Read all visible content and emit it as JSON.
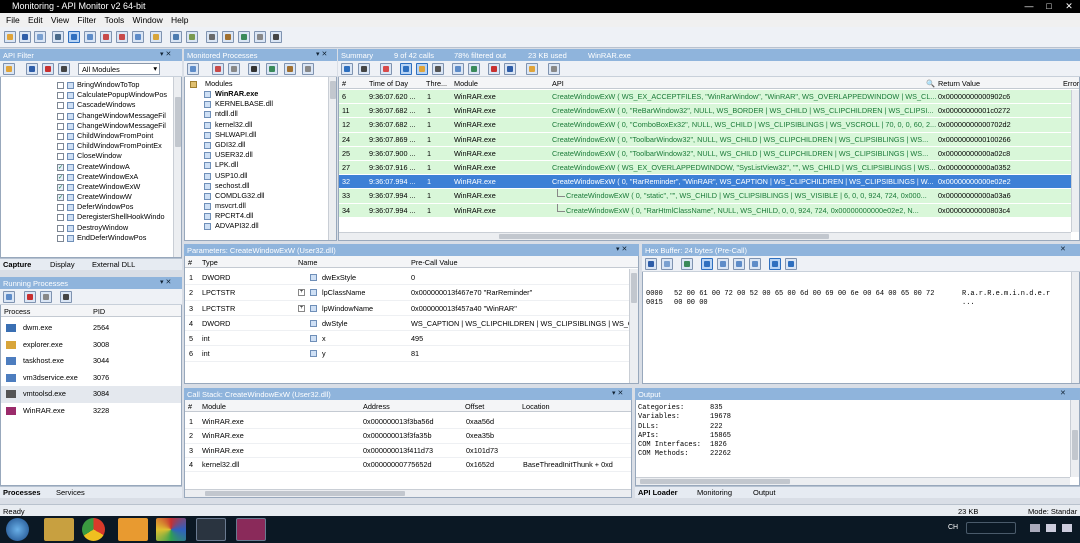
{
  "window": {
    "title": "Monitoring - API Monitor v2 64-bit"
  },
  "menu": [
    "File",
    "Edit",
    "View",
    "Filter",
    "Tools",
    "Window",
    "Help"
  ],
  "api_filter": {
    "title": "API Filter",
    "dropdown": "All Modules",
    "items": [
      {
        "label": "BringWindowToTop",
        "checked": false
      },
      {
        "label": "CalculatePopupWindowPos",
        "checked": false
      },
      {
        "label": "CascadeWindows",
        "checked": false
      },
      {
        "label": "ChangeWindowMessageFil",
        "checked": false
      },
      {
        "label": "ChangeWindowMessageFil",
        "checked": false
      },
      {
        "label": "ChildWindowFromPoint",
        "checked": false
      },
      {
        "label": "ChildWindowFromPointEx",
        "checked": false
      },
      {
        "label": "CloseWindow",
        "checked": false
      },
      {
        "label": "CreateWindowA",
        "checked": true
      },
      {
        "label": "CreateWindowExA",
        "checked": true
      },
      {
        "label": "CreateWindowExW",
        "checked": true
      },
      {
        "label": "CreateWindowW",
        "checked": true
      },
      {
        "label": "DeferWindowPos",
        "checked": false
      },
      {
        "label": "DeregisterShellHookWindo",
        "checked": false
      },
      {
        "label": "DestroyWindow",
        "checked": false
      },
      {
        "label": "EndDeferWindowPos",
        "checked": false
      }
    ],
    "tabs": [
      "Capture",
      "Display",
      "External DLL"
    ]
  },
  "monitored_processes": {
    "title": "Monitored Processes",
    "root": "Modules",
    "items": [
      "WinRAR.exe",
      "KERNELBASE.dll",
      "ntdll.dll",
      "kernel32.dll",
      "SHLWAPI.dll",
      "GDI32.dll",
      "USER32.dll",
      "LPK.dll",
      "USP10.dll",
      "sechost.dll",
      "COMDLG32.dll",
      "msvcrt.dll",
      "RPCRT4.dll",
      "ADVAPI32.dll"
    ]
  },
  "summary": {
    "title": "Summary",
    "calls": "9 of 42 calls",
    "filtered": "78% filtered out",
    "used": "23 KB used",
    "process": "WinRAR.exe",
    "columns": [
      "#",
      "Time of Day",
      "Thre...",
      "Module",
      "API",
      "Return Value",
      "Error"
    ],
    "rows": [
      {
        "n": "6",
        "time": "9:36:07.620 ...",
        "thread": "1",
        "module": "WinRAR.exe",
        "api": "CreateWindowExW ( WS_EX_ACCEPTFILES, \"WinRarWindow\", \"WinRAR\", WS_OVERLAPPEDWINDOW | WS_CL...",
        "ret": "0x00000000000902c6",
        "indent": 0,
        "selected": false
      },
      {
        "n": "11",
        "time": "9:36:07.682 ...",
        "thread": "1",
        "module": "WinRAR.exe",
        "api": "CreateWindowExW ( 0, \"ReBarWindow32\", NULL, WS_BORDER | WS_CHILD | WS_CLIPCHILDREN | WS_CLIPSI...",
        "ret": "0x00000000001c0272",
        "indent": 0,
        "selected": false
      },
      {
        "n": "12",
        "time": "9:36:07.682 ...",
        "thread": "1",
        "module": "WinRAR.exe",
        "api": "CreateWindowExW ( 0, \"ComboBoxEx32\", NULL, WS_CHILD | WS_CLIPSIBLINGS | WS_VSCROLL | 70, 0, 0, 60, 2...",
        "ret": "0x00000000000702d2",
        "indent": 0,
        "selected": false
      },
      {
        "n": "24",
        "time": "9:36:07.869 ...",
        "thread": "1",
        "module": "WinRAR.exe",
        "api": "CreateWindowExW ( 0, \"ToolbarWindow32\", NULL, WS_CHILD | WS_CLIPCHILDREN | WS_CLIPSIBLINGS | WS...",
        "ret": "0x0000000000100266",
        "indent": 0,
        "selected": false
      },
      {
        "n": "25",
        "time": "9:36:07.900 ...",
        "thread": "1",
        "module": "WinRAR.exe",
        "api": "CreateWindowExW ( 0, \"ToolbarWindow32\", NULL, WS_CHILD | WS_CLIPCHILDREN | WS_CLIPSIBLINGS | WS...",
        "ret": "0x00000000000a02c8",
        "indent": 0,
        "selected": false
      },
      {
        "n": "27",
        "time": "9:36:07.916 ...",
        "thread": "1",
        "module": "WinRAR.exe",
        "api": "CreateWindowExW ( WS_EX_OVERLAPPEDWINDOW, \"SysListView32\", \"\", WS_CHILD | WS_CLIPSIBLINGS | WS...",
        "ret": "0x00000000000a0352",
        "indent": 0,
        "selected": false
      },
      {
        "n": "32",
        "time": "9:36:07.994 ...",
        "thread": "1",
        "module": "WinRAR.exe",
        "api": "CreateWindowExW ( 0, \"RarReminder\", \"WinRAR\", WS_CAPTION | WS_CLIPCHILDREN | WS_CLIPSIBLINGS | W...",
        "ret": "0x00000000000e02e2",
        "indent": 0,
        "selected": true
      },
      {
        "n": "33",
        "time": "9:36:07.994 ...",
        "thread": "1",
        "module": "WinRAR.exe",
        "api": "CreateWindowExW ( 0, \"static\", \"\", WS_CHILD | WS_CLIPSIBLINGS | WS_VISIBLE | 6, 0, 0, 924, 724, 0x000...",
        "ret": "0x00000000000a03a6",
        "indent": 1,
        "selected": false
      },
      {
        "n": "34",
        "time": "9:36:07.994 ...",
        "thread": "1",
        "module": "WinRAR.exe",
        "api": "CreateWindowExW ( 0, \"RarHtmlClassName\", NULL, WS_CHILD, 0, 0, 924, 724, 0x00000000000e02e2, N...",
        "ret": "0x00000000000803c4",
        "indent": 1,
        "selected": false
      }
    ]
  },
  "parameters": {
    "title": "Parameters: CreateWindowExW (User32.dll)",
    "columns": [
      "#",
      "Type",
      "Name",
      "Pre-Call Value"
    ],
    "rows": [
      {
        "n": "1",
        "type": "DWORD",
        "name": "dwExStyle",
        "value": "0",
        "expand": false
      },
      {
        "n": "2",
        "type": "LPCTSTR",
        "name": "lpClassName",
        "value": "0x000000013f467e70 \"RarReminder\"",
        "expand": true
      },
      {
        "n": "3",
        "type": "LPCTSTR",
        "name": "lpWindowName",
        "value": "0x000000013f457a40 \"WinRAR\"",
        "expand": true
      },
      {
        "n": "4",
        "type": "DWORD",
        "name": "dwStyle",
        "value": "WS_CAPTION | WS_CLIPCHILDREN | WS_CLIPSIBLINGS | WS_G",
        "expand": false
      },
      {
        "n": "5",
        "type": "int",
        "name": "x",
        "value": "495",
        "expand": false
      },
      {
        "n": "6",
        "type": "int",
        "name": "y",
        "value": "81",
        "expand": false
      }
    ]
  },
  "hex_buffer": {
    "title": "Hex Buffer: 24 bytes (Pre-Call)",
    "lines": [
      {
        "offset": "0000",
        "bytes": "52 00 61 00 72 00 52 00 65 00 6d 00 69 00 6e 00 64 00 65 00 72",
        "ascii": "R.a.r.R.e.m.i.n.d.e.r"
      },
      {
        "offset": "0015",
        "bytes": "00 00 00",
        "ascii": "..."
      }
    ]
  },
  "running_processes": {
    "title": "Running Processes",
    "columns": [
      "Process",
      "PID"
    ],
    "rows": [
      {
        "name": "dwm.exe",
        "pid": "2564",
        "color": "#3a6fb3"
      },
      {
        "name": "explorer.exe",
        "pid": "3008",
        "color": "#d8a53a"
      },
      {
        "name": "taskhost.exe",
        "pid": "3044",
        "color": "#4d7dbf"
      },
      {
        "name": "vm3dservice.exe",
        "pid": "3076",
        "color": "#4d7dbf"
      },
      {
        "name": "vmtoolsd.exe",
        "pid": "3084",
        "color": "#555555"
      },
      {
        "name": "WinRAR.exe",
        "pid": "3228",
        "color": "#9b2b6b"
      }
    ],
    "tabs": [
      "Processes",
      "Services"
    ]
  },
  "call_stack": {
    "title": "Call Stack: CreateWindowExW (User32.dll)",
    "columns": [
      "#",
      "Module",
      "Address",
      "Offset",
      "Location"
    ],
    "rows": [
      {
        "n": "1",
        "module": "WinRAR.exe",
        "address": "0x000000013f3ba56d",
        "offset": "0xaa56d",
        "location": ""
      },
      {
        "n": "2",
        "module": "WinRAR.exe",
        "address": "0x000000013f3fa35b",
        "offset": "0xea35b",
        "location": ""
      },
      {
        "n": "3",
        "module": "WinRAR.exe",
        "address": "0x000000013f411d73",
        "offset": "0x101d73",
        "location": ""
      },
      {
        "n": "4",
        "module": "kernel32.dll",
        "address": "0x00000000775652d",
        "offset": "0x1652d",
        "location": "BaseThreadInitThunk + 0xd"
      }
    ]
  },
  "output": {
    "title": "Output",
    "lines": [
      {
        "k": "Categories:",
        "v": "835"
      },
      {
        "k": "Variables:",
        "v": "19678"
      },
      {
        "k": "DLLs:",
        "v": "222"
      },
      {
        "k": "APIs:",
        "v": "15865"
      },
      {
        "k": "COM Interfaces:",
        "v": "1826"
      },
      {
        "k": "COM Methods:",
        "v": "22262"
      }
    ],
    "tabs": [
      "API Loader",
      "Monitoring",
      "Output"
    ]
  },
  "statusbar": {
    "left": "Ready",
    "size": "23 KB",
    "mode": "Mode: Standar"
  },
  "taskbar": {
    "lang": "CH",
    "items": [
      "start",
      "explorer",
      "chrome",
      "app1",
      "app2",
      "apimonitor",
      "winrar"
    ]
  }
}
